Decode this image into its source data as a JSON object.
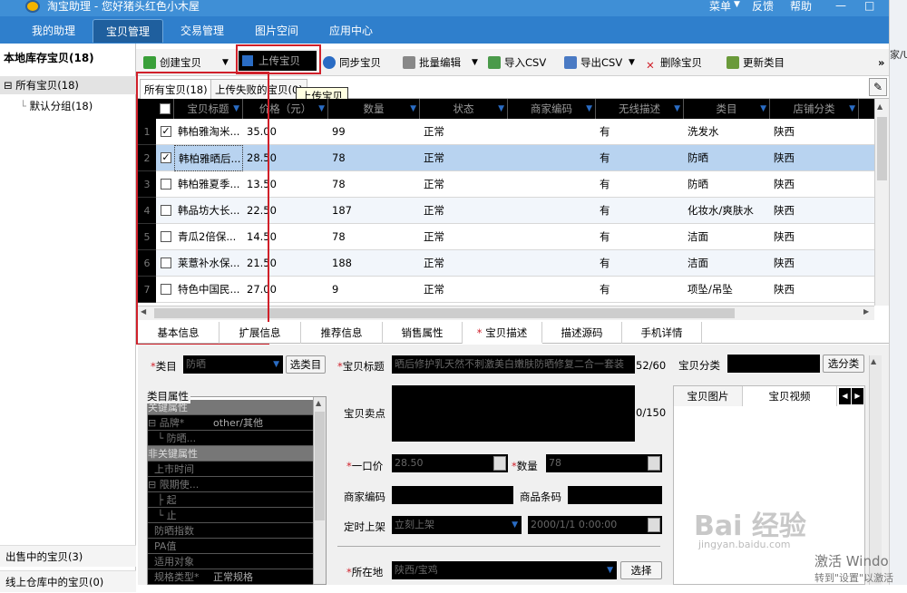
{
  "titlebar": {
    "title": "淘宝助理 - 您好猪头红色小木屋",
    "menu": [
      "菜单",
      "反馈",
      "帮助"
    ],
    "window_controls": [
      "—",
      "□"
    ]
  },
  "main_tabs": [
    {
      "label": "我的助理",
      "active": false
    },
    {
      "label": "宝贝管理",
      "active": true
    },
    {
      "label": "交易管理",
      "active": false
    },
    {
      "label": "图片空间",
      "active": false
    },
    {
      "label": "应用中心",
      "active": false
    }
  ],
  "right_strip_text": "家/U",
  "sidebar": {
    "header": "本地库存宝贝(18)",
    "items": [
      {
        "label": "所有宝贝(18)",
        "expander": "⊟",
        "selected": true
      },
      {
        "label": "默认分组(18)",
        "expander": "",
        "selected": false
      }
    ],
    "bottom_items": [
      "出售中的宝贝(3)",
      "线上仓库中的宝贝(0)"
    ]
  },
  "toolbar": {
    "create": "创建宝贝",
    "create_dropdown": "▼",
    "upload": "上传宝贝",
    "sync": "同步宝贝",
    "batch_edit": "批量编辑",
    "batch_dropdown": "▼",
    "import_csv": "导入CSV",
    "export_csv": "导出CSV",
    "export_dropdown": "▼",
    "delete": "删除宝贝",
    "update_category": "更新类目",
    "more": "»"
  },
  "subtabs": [
    {
      "label": "所有宝贝(18)",
      "active": true
    },
    {
      "label": "上传失败的宝贝(0)",
      "active": false
    }
  ],
  "tooltip": "上传宝贝",
  "table": {
    "columns": [
      "宝贝标题",
      "价格（元）",
      "数量",
      "状态",
      "商家编码",
      "无线描述",
      "类目",
      "店铺分类"
    ],
    "rows": [
      {
        "n": "1",
        "checked": true,
        "title": "韩柏雅淘米...",
        "price": "35.00",
        "qty": "99",
        "status": "正常",
        "code": "",
        "wireless": "有",
        "category": "洗发水",
        "shop": "陕西"
      },
      {
        "n": "2",
        "checked": true,
        "title": "韩柏雅晒后...",
        "price": "28.50",
        "qty": "78",
        "status": "正常",
        "code": "",
        "wireless": "有",
        "category": "防晒",
        "shop": "陕西"
      },
      {
        "n": "3",
        "checked": false,
        "title": "韩柏雅夏季...",
        "price": "13.50",
        "qty": "78",
        "status": "正常",
        "code": "",
        "wireless": "有",
        "category": "防晒",
        "shop": "陕西"
      },
      {
        "n": "4",
        "checked": false,
        "title": "韩品坊大长...",
        "price": "22.50",
        "qty": "187",
        "status": "正常",
        "code": "",
        "wireless": "有",
        "category": "化妆水/爽肤水",
        "shop": "陕西"
      },
      {
        "n": "5",
        "checked": false,
        "title": "青瓜2倍保...",
        "price": "14.50",
        "qty": "78",
        "status": "正常",
        "code": "",
        "wireless": "有",
        "category": "洁面",
        "shop": "陕西"
      },
      {
        "n": "6",
        "checked": false,
        "title": "莱薏补水保...",
        "price": "21.50",
        "qty": "188",
        "status": "正常",
        "code": "",
        "wireless": "有",
        "category": "洁面",
        "shop": "陕西"
      },
      {
        "n": "7",
        "checked": false,
        "title": "特色中国民...",
        "price": "27.00",
        "qty": "9",
        "status": "正常",
        "code": "",
        "wireless": "有",
        "category": "项坠/吊坠",
        "shop": "陕西"
      }
    ]
  },
  "bottom_tabs": [
    "基本信息",
    "扩展信息",
    "推荐信息",
    "销售属性",
    "宝贝描述",
    "描述源码",
    "手机详情"
  ],
  "form": {
    "category_label": "类目",
    "category_value": "防晒",
    "select_category_btn": "选类目",
    "attr_legend": "类目属性",
    "attr_rows": [
      {
        "type": "grp",
        "text": "关键属性",
        "value": ""
      },
      {
        "type": "item",
        "text": "⊟ 品牌*",
        "value": "other/其他"
      },
      {
        "type": "item",
        "text": "   └ 防晒...",
        "value": ""
      },
      {
        "type": "grp",
        "text": "非关键属性",
        "value": ""
      },
      {
        "type": "item",
        "text": "  上市时间",
        "value": ""
      },
      {
        "type": "item",
        "text": "⊟ 限期使...",
        "value": ""
      },
      {
        "type": "item",
        "text": "   ├ 起",
        "value": ""
      },
      {
        "type": "item",
        "text": "   └ 止",
        "value": ""
      },
      {
        "type": "item",
        "text": "  防晒指数",
        "value": ""
      },
      {
        "type": "item",
        "text": "  PA值",
        "value": ""
      },
      {
        "type": "item",
        "text": "  适用对象",
        "value": ""
      },
      {
        "type": "item",
        "text": "  规格类型*",
        "value": "正常规格"
      }
    ],
    "title_label": "宝贝标题",
    "title_value": "晒后修护乳天然不刺激美白嫩肤防晒修复二合一套装",
    "title_count": "52/60",
    "selling_label": "宝贝卖点",
    "selling_count": "0/150",
    "price_label": "一口价",
    "price_value": "28.50",
    "qty_label": "数量",
    "qty_value": "78",
    "merchant_code_label": "商家编码",
    "barcode_label": "商品条码",
    "schedule_label": "定时上架",
    "schedule_value": "立刻上架",
    "schedule_time": "2000/1/1 0:00:00",
    "location_label": "所在地",
    "location_value": "陕西/宝鸡",
    "location_btn": "选择",
    "shop_category_label": "宝贝分类",
    "shop_category_btn": "选分类",
    "media_tabs": [
      "宝贝图片",
      "宝贝视频"
    ]
  },
  "watermark": {
    "text": "Bai 经验",
    "sub": "jingyan.baidu.com"
  },
  "activation": {
    "line1": "激活 Windo",
    "line2": "转到\"设置\"以激活"
  }
}
